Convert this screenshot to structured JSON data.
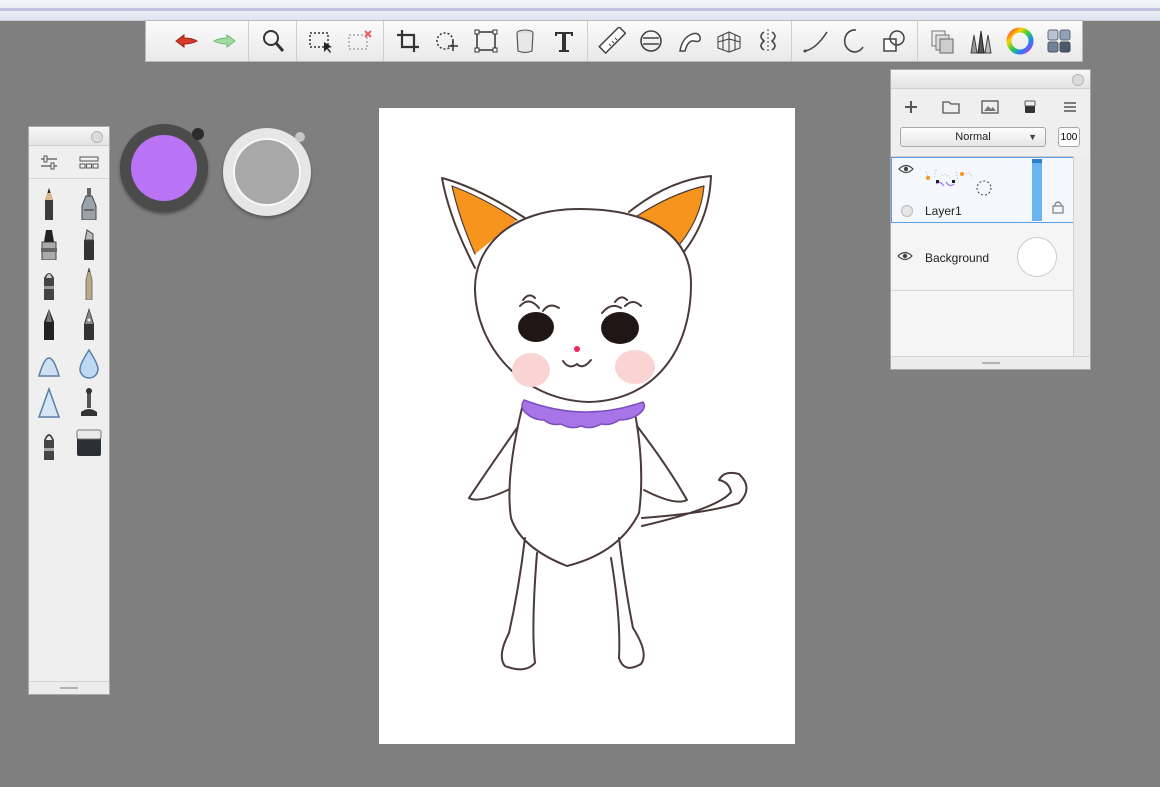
{
  "toolbar": {
    "tools": [
      {
        "name": "undo-icon"
      },
      {
        "name": "redo-icon"
      },
      {
        "name": "magnifier-icon"
      },
      {
        "name": "selection-icon"
      },
      {
        "name": "selection-clear-icon"
      },
      {
        "name": "crop-icon"
      },
      {
        "name": "transform-icon"
      },
      {
        "name": "distort-icon"
      },
      {
        "name": "fill-bucket-icon"
      },
      {
        "name": "text-icon"
      },
      {
        "name": "ruler-icon"
      },
      {
        "name": "ellipse-guide-icon"
      },
      {
        "name": "french-curve-icon"
      },
      {
        "name": "perspective-icon"
      },
      {
        "name": "symmetry-icon"
      },
      {
        "name": "stroke-line-icon"
      },
      {
        "name": "stroke-ellipse-icon"
      },
      {
        "name": "stroke-shape-icon"
      },
      {
        "name": "layers-icon"
      },
      {
        "name": "brush-library-icon"
      },
      {
        "name": "color-wheel-icon"
      },
      {
        "name": "copic-palette-icon"
      }
    ]
  },
  "colors": {
    "primary_puck": "#bb73f5",
    "secondary_puck": "#a8a8a8"
  },
  "layer_panel": {
    "blend_mode": "Normal",
    "opacity": "100",
    "layers": [
      {
        "name": "Layer1",
        "selected": true
      },
      {
        "name": "Background",
        "selected": false
      }
    ]
  }
}
